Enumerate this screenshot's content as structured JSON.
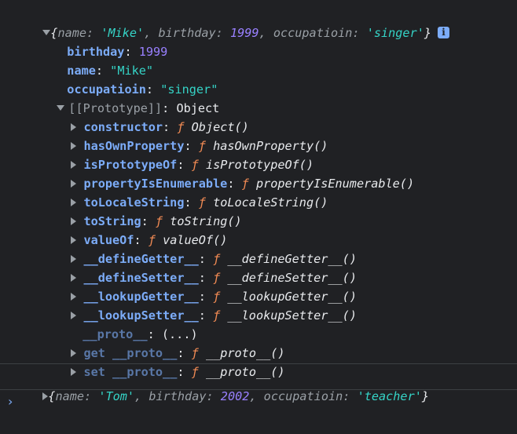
{
  "object1": {
    "preview": {
      "open": "{",
      "k_name": "name",
      "v_name": "'Mike'",
      "k_birthday": "birthday",
      "v_birthday": "1999",
      "k_occ": "occupatioin",
      "v_occ": "'singer'",
      "close": "}",
      "info_icon": "i"
    },
    "properties": [
      {
        "key": "birthday",
        "value": "1999"
      },
      {
        "key": "name",
        "value": "\"Mike\""
      },
      {
        "key": "occupatioin",
        "value": "\"singer\""
      }
    ],
    "prototype": {
      "label": "[[Prototype]]",
      "value": "Object",
      "methods": [
        {
          "key": "constructor",
          "fn": "Object()"
        },
        {
          "key": "hasOwnProperty",
          "fn": "hasOwnProperty()"
        },
        {
          "key": "isPrototypeOf",
          "fn": "isPrototypeOf()"
        },
        {
          "key": "propertyIsEnumerable",
          "fn": "propertyIsEnumerable()"
        },
        {
          "key": "toLocaleString",
          "fn": "toLocaleString()"
        },
        {
          "key": "toString",
          "fn": "toString()"
        },
        {
          "key": "valueOf",
          "fn": "valueOf()"
        },
        {
          "key": "__defineGetter__",
          "fn": "__defineGetter__()"
        },
        {
          "key": "__defineSetter__",
          "fn": "__defineSetter__()"
        },
        {
          "key": "__lookupGetter__",
          "fn": "__lookupGetter__()"
        },
        {
          "key": "__lookupSetter__",
          "fn": "__lookupSetter__()"
        }
      ],
      "proto_key": "__proto__",
      "proto_value": "(...)",
      "getter": {
        "prefix": "get",
        "key": "__proto__",
        "fn": "__proto__()"
      },
      "setter": {
        "prefix": "set",
        "key": "__proto__",
        "fn": "__proto__()"
      }
    }
  },
  "object2": {
    "preview": {
      "open": "{",
      "k_name": "name",
      "v_name": "'Tom'",
      "k_birthday": "birthday",
      "v_birthday": "2002",
      "k_occ": "occupatioin",
      "v_occ": "'teacher'",
      "close": "}"
    }
  },
  "console": {
    "prompt_symbol": "›",
    "f_symbol": "ƒ"
  },
  "colors": {
    "background": "#202124",
    "key": "#7cacf8",
    "string": "#35d4c7",
    "number": "#9980ff",
    "function_symbol": "#f28b54",
    "text": "#e8eaed"
  }
}
